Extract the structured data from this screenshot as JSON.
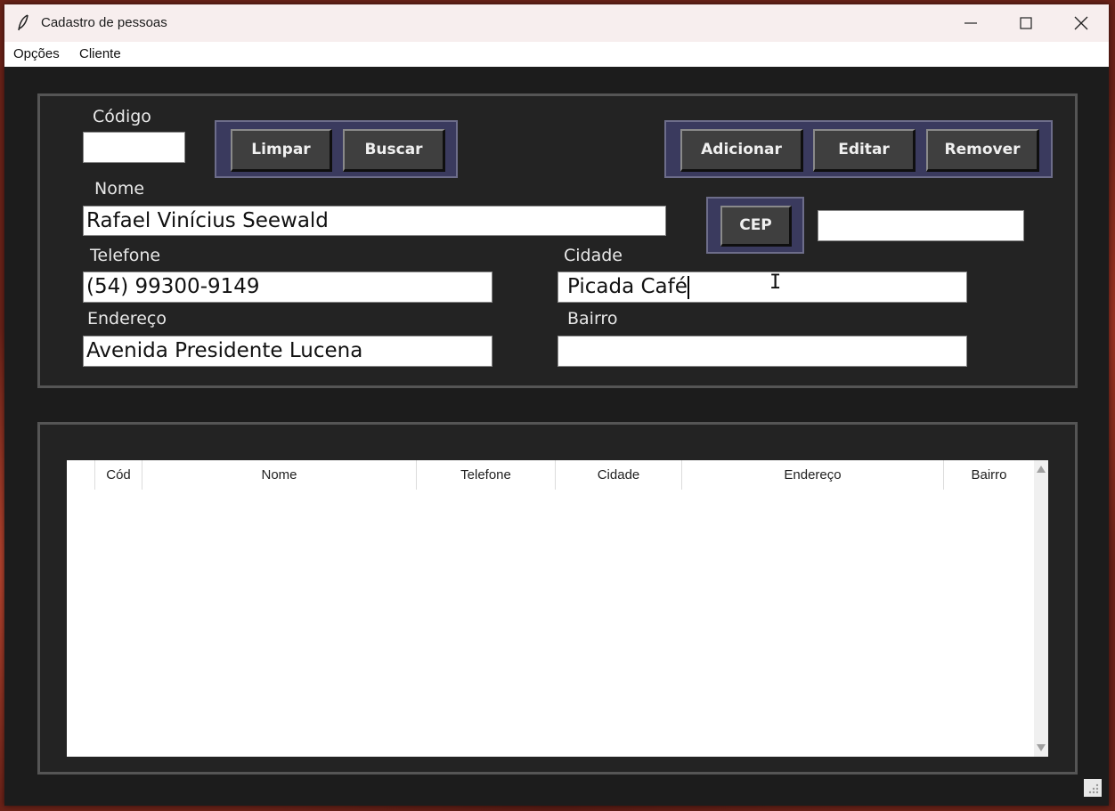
{
  "window": {
    "title": "Cadastro de pessoas",
    "controls": {
      "minimize": "—",
      "maximize": "☐",
      "close": "✕"
    }
  },
  "menu": [
    "Opções",
    "Cliente"
  ],
  "form": {
    "codigo": {
      "label": "Código",
      "value": ""
    },
    "nome": {
      "label": "Nome",
      "value": "Rafael Vinícius Seewald"
    },
    "telefone": {
      "label": "Telefone",
      "value": "(54) 99300-9149"
    },
    "cidade": {
      "label": "Cidade",
      "value": "Picada Café"
    },
    "endereco": {
      "label": "Endereço",
      "value": "Avenida Presidente Lucena"
    },
    "bairro": {
      "label": "Bairro",
      "value": ""
    },
    "cep": {
      "button_label": "CEP",
      "value": ""
    }
  },
  "buttons": {
    "limpar": "Limpar",
    "buscar": "Buscar",
    "adicionar": "Adicionar",
    "editar": "Editar",
    "remover": "Remover"
  },
  "table": {
    "columns": [
      "Cód",
      "Nome",
      "Telefone",
      "Cidade",
      "Endereço",
      "Bairro"
    ],
    "rows": []
  },
  "colors": {
    "background": "#1c1c1c",
    "frame_border": "#555555",
    "button_group": "#3a3a5e",
    "button": "#3f3f3f"
  }
}
